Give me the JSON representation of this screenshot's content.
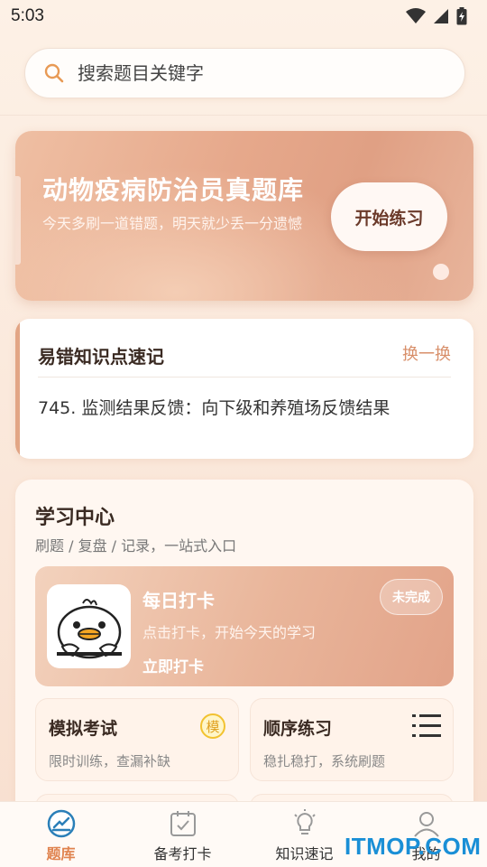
{
  "status_bar": {
    "time": "5:03"
  },
  "search": {
    "placeholder": "搜索题目关键字"
  },
  "banner": {
    "title": "动物疫病防治员真题库",
    "subtitle": "今天多刷一道错题，明天就少丢一分遗憾",
    "button_label": "开始练习"
  },
  "knowledge_card": {
    "title": "易错知识点速记",
    "switch_label": "换一换",
    "item": "745. 监测结果反馈：向下级和养殖场反馈结果"
  },
  "study_center": {
    "title": "学习中心",
    "subtitle": "刷题 / 复盘 / 记录，一站式入口",
    "daily": {
      "title": "每日打卡",
      "subtitle": "点击打卡，开始今天的学习",
      "link": "立即打卡",
      "badge": "未完成"
    },
    "tiles": [
      {
        "title": "模拟考试",
        "subtitle": "限时训练，查漏补缺",
        "icon": "mock-exam-icon",
        "icon_char": "模"
      },
      {
        "title": "顺序练习",
        "subtitle": "稳扎稳打，系统刷题",
        "icon": "list-icon"
      }
    ]
  },
  "tabbar": {
    "items": [
      {
        "label": "题库",
        "icon": "question-bank-icon",
        "active": true
      },
      {
        "label": "备考打卡",
        "icon": "calendar-check-icon",
        "active": false
      },
      {
        "label": "知识速记",
        "icon": "bulb-icon",
        "active": false
      },
      {
        "label": "我的",
        "icon": "user-icon",
        "active": false
      }
    ]
  },
  "watermark": "ITMOP.COM",
  "colors": {
    "accent": "#e0834f",
    "brand_gradient_start": "#efbfa3",
    "brand_gradient_end": "#e2a389"
  }
}
